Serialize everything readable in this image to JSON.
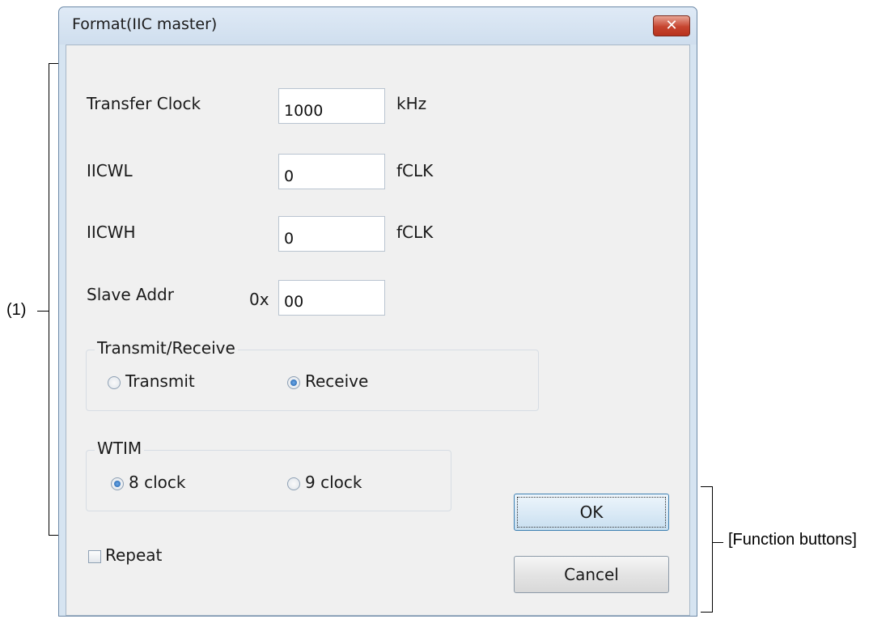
{
  "window": {
    "title": "Format(IIC master)",
    "close_glyph": "✕"
  },
  "fields": {
    "transfer_clock": {
      "label": "Transfer Clock",
      "value": "1000",
      "unit": "kHz"
    },
    "iicwl": {
      "label": "IICWL",
      "value": "0",
      "unit": "fCLK"
    },
    "iicwh": {
      "label": "IICWH",
      "value": "0",
      "unit": "fCLK"
    },
    "slave_addr": {
      "label": "Slave Addr",
      "prefix": "0x",
      "value": "00"
    }
  },
  "transmit_receive": {
    "title": "Transmit/Receive",
    "options": [
      {
        "label": "Transmit",
        "checked": false
      },
      {
        "label": "Receive",
        "checked": true
      }
    ]
  },
  "wtim": {
    "title": "WTIM",
    "options": [
      {
        "label": "8 clock",
        "checked": true
      },
      {
        "label": "9 clock",
        "checked": false
      }
    ]
  },
  "repeat": {
    "label": "Repeat",
    "checked": false
  },
  "buttons": {
    "ok": "OK",
    "cancel": "Cancel"
  },
  "annotations": {
    "area_label": "(1)",
    "buttons_label": "[Function buttons]"
  },
  "colors": {
    "accent": "#1e5fa8",
    "close": "#c6442f",
    "dialog_bg": "#f0f0f0",
    "frame": "#d6e4f1"
  }
}
